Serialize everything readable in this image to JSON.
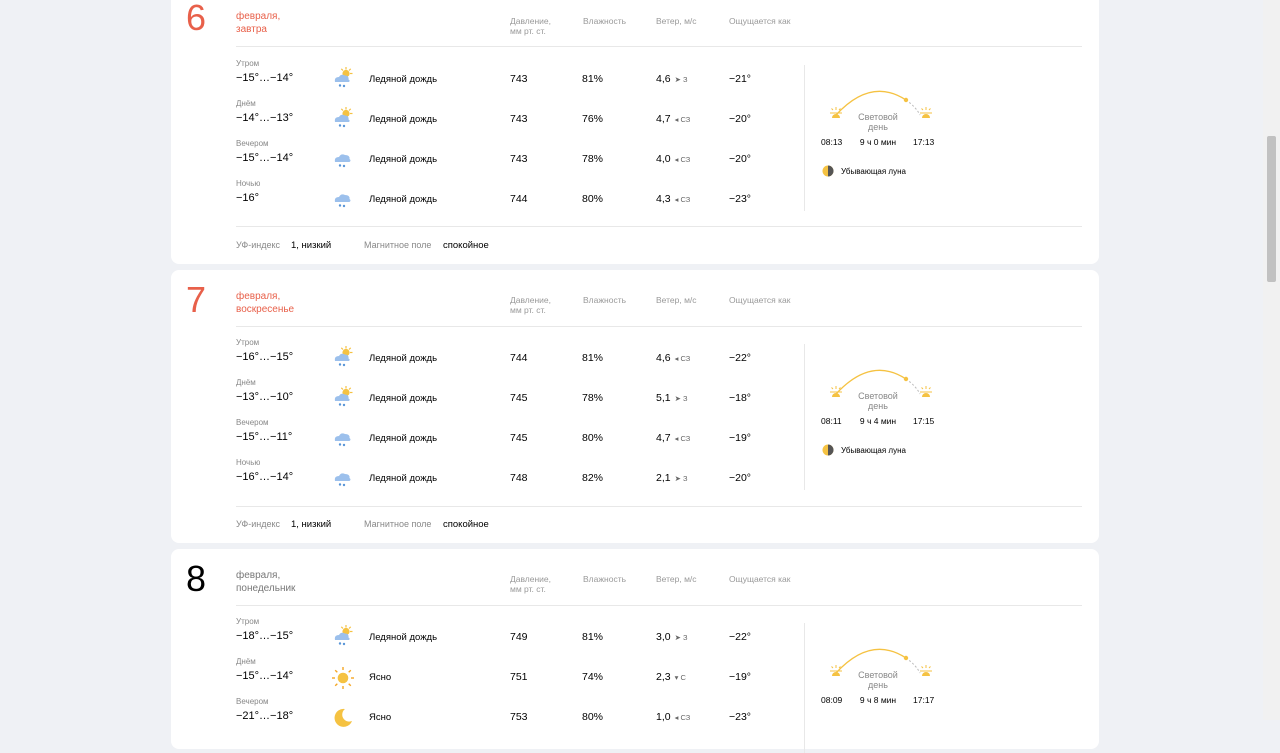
{
  "days": [
    {
      "number": "6",
      "month": "февраля,",
      "weekday": "завтра",
      "headers": {
        "pressure_1": "Давление,",
        "pressure_2": "мм рт. ст.",
        "humidity": "Влажность",
        "wind": "Ветер, м/с",
        "feels": "Ощущается как"
      },
      "rows": [
        {
          "label": "Утром",
          "temp": "−15°…−14°",
          "icon": "sun-cloud-freezing-rain-icon",
          "cond": "Ледяной дождь",
          "pressure": "743",
          "humidity": "81%",
          "wind": "4,6",
          "wind_dir": "➤ З",
          "feels": "−21°"
        },
        {
          "label": "Днём",
          "temp": "−14°…−13°",
          "icon": "sun-cloud-freezing-rain-icon",
          "cond": "Ледяной дождь",
          "pressure": "743",
          "humidity": "76%",
          "wind": "4,7",
          "wind_dir": "◂ СЗ",
          "feels": "−20°"
        },
        {
          "label": "Вечером",
          "temp": "−15°…−14°",
          "icon": "cloud-freezing-rain-icon",
          "cond": "Ледяной дождь",
          "pressure": "743",
          "humidity": "78%",
          "wind": "4,0",
          "wind_dir": "◂ СЗ",
          "feels": "−20°"
        },
        {
          "label": "Ночью",
          "temp": "−16°",
          "icon": "cloud-freezing-rain-icon",
          "cond": "Ледяной дождь",
          "pressure": "744",
          "humidity": "80%",
          "wind": "4,3",
          "wind_dir": "◂ СЗ",
          "feels": "−23°"
        }
      ],
      "sun": {
        "label_1": "Световой",
        "label_2": "день",
        "duration": "9 ч 0 мин",
        "sunrise": "08:13",
        "sunset": "17:13"
      },
      "moon": "Убывающая луна",
      "footer": {
        "uv_label": "УФ-индекс",
        "uv_value": "1, низкий",
        "mag_label": "Магнитное поле",
        "mag_value": "спокойное"
      }
    },
    {
      "number": "7",
      "month": "февраля,",
      "weekday": "воскресенье",
      "headers": {
        "pressure_1": "Давление,",
        "pressure_2": "мм рт. ст.",
        "humidity": "Влажность",
        "wind": "Ветер, м/с",
        "feels": "Ощущается как"
      },
      "rows": [
        {
          "label": "Утром",
          "temp": "−16°…−15°",
          "icon": "sun-cloud-freezing-rain-icon",
          "cond": "Ледяной дождь",
          "pressure": "744",
          "humidity": "81%",
          "wind": "4,6",
          "wind_dir": "◂ СЗ",
          "feels": "−22°"
        },
        {
          "label": "Днём",
          "temp": "−13°…−10°",
          "icon": "sun-cloud-freezing-rain-icon",
          "cond": "Ледяной дождь",
          "pressure": "745",
          "humidity": "78%",
          "wind": "5,1",
          "wind_dir": "➤ З",
          "feels": "−18°"
        },
        {
          "label": "Вечером",
          "temp": "−15°…−11°",
          "icon": "cloud-freezing-rain-icon",
          "cond": "Ледяной дождь",
          "pressure": "745",
          "humidity": "80%",
          "wind": "4,7",
          "wind_dir": "◂ СЗ",
          "feels": "−19°"
        },
        {
          "label": "Ночью",
          "temp": "−16°…−14°",
          "icon": "cloud-freezing-rain-icon",
          "cond": "Ледяной дождь",
          "pressure": "748",
          "humidity": "82%",
          "wind": "2,1",
          "wind_dir": "➤ З",
          "feels": "−20°"
        }
      ],
      "sun": {
        "label_1": "Световой",
        "label_2": "день",
        "duration": "9 ч 4 мин",
        "sunrise": "08:11",
        "sunset": "17:15"
      },
      "moon": "Убывающая луна",
      "footer": {
        "uv_label": "УФ-индекс",
        "uv_value": "1, низкий",
        "mag_label": "Магнитное поле",
        "mag_value": "спокойное"
      }
    },
    {
      "number": "8",
      "month": "февраля,",
      "weekday": "понедельник",
      "headers": {
        "pressure_1": "Давление,",
        "pressure_2": "мм рт. ст.",
        "humidity": "Влажность",
        "wind": "Ветер, м/с",
        "feels": "Ощущается как"
      },
      "rows": [
        {
          "label": "Утром",
          "temp": "−18°…−15°",
          "icon": "sun-cloud-freezing-rain-icon",
          "cond": "Ледяной дождь",
          "pressure": "749",
          "humidity": "81%",
          "wind": "3,0",
          "wind_dir": "➤ З",
          "feels": "−22°"
        },
        {
          "label": "Днём",
          "temp": "−15°…−14°",
          "icon": "sun-icon",
          "cond": "Ясно",
          "pressure": "751",
          "humidity": "74%",
          "wind": "2,3",
          "wind_dir": "▾ С",
          "feels": "−19°"
        },
        {
          "label": "Вечером",
          "temp": "−21°…−18°",
          "icon": "moon-icon",
          "cond": "Ясно",
          "pressure": "753",
          "humidity": "80%",
          "wind": "1,0",
          "wind_dir": "◂ СЗ",
          "feels": "−23°"
        }
      ],
      "sun": {
        "label_1": "Световой",
        "label_2": "день",
        "duration": "9 ч 8 мин",
        "sunrise": "08:09",
        "sunset": "17:17"
      },
      "moon": "",
      "footer": null
    }
  ],
  "colors": {
    "accent_red": "#e8604a",
    "sun_yellow": "#f5c242",
    "cloud_blue": "#8fb8e8"
  }
}
